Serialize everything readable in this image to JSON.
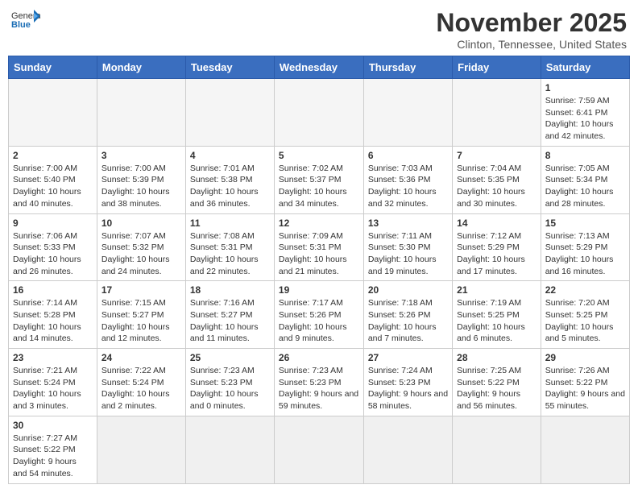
{
  "header": {
    "logo_general": "General",
    "logo_blue": "Blue",
    "month_title": "November 2025",
    "subtitle": "Clinton, Tennessee, United States"
  },
  "days_of_week": [
    "Sunday",
    "Monday",
    "Tuesday",
    "Wednesday",
    "Thursday",
    "Friday",
    "Saturday"
  ],
  "weeks": [
    [
      {
        "day": "",
        "info": ""
      },
      {
        "day": "",
        "info": ""
      },
      {
        "day": "",
        "info": ""
      },
      {
        "day": "",
        "info": ""
      },
      {
        "day": "",
        "info": ""
      },
      {
        "day": "",
        "info": ""
      },
      {
        "day": "1",
        "info": "Sunrise: 7:59 AM\nSunset: 6:41 PM\nDaylight: 10 hours and 42 minutes."
      }
    ],
    [
      {
        "day": "2",
        "info": "Sunrise: 7:00 AM\nSunset: 5:40 PM\nDaylight: 10 hours and 40 minutes."
      },
      {
        "day": "3",
        "info": "Sunrise: 7:00 AM\nSunset: 5:39 PM\nDaylight: 10 hours and 38 minutes."
      },
      {
        "day": "4",
        "info": "Sunrise: 7:01 AM\nSunset: 5:38 PM\nDaylight: 10 hours and 36 minutes."
      },
      {
        "day": "5",
        "info": "Sunrise: 7:02 AM\nSunset: 5:37 PM\nDaylight: 10 hours and 34 minutes."
      },
      {
        "day": "6",
        "info": "Sunrise: 7:03 AM\nSunset: 5:36 PM\nDaylight: 10 hours and 32 minutes."
      },
      {
        "day": "7",
        "info": "Sunrise: 7:04 AM\nSunset: 5:35 PM\nDaylight: 10 hours and 30 minutes."
      },
      {
        "day": "8",
        "info": "Sunrise: 7:05 AM\nSunset: 5:34 PM\nDaylight: 10 hours and 28 minutes."
      }
    ],
    [
      {
        "day": "9",
        "info": "Sunrise: 7:06 AM\nSunset: 5:33 PM\nDaylight: 10 hours and 26 minutes."
      },
      {
        "day": "10",
        "info": "Sunrise: 7:07 AM\nSunset: 5:32 PM\nDaylight: 10 hours and 24 minutes."
      },
      {
        "day": "11",
        "info": "Sunrise: 7:08 AM\nSunset: 5:31 PM\nDaylight: 10 hours and 22 minutes."
      },
      {
        "day": "12",
        "info": "Sunrise: 7:09 AM\nSunset: 5:31 PM\nDaylight: 10 hours and 21 minutes."
      },
      {
        "day": "13",
        "info": "Sunrise: 7:11 AM\nSunset: 5:30 PM\nDaylight: 10 hours and 19 minutes."
      },
      {
        "day": "14",
        "info": "Sunrise: 7:12 AM\nSunset: 5:29 PM\nDaylight: 10 hours and 17 minutes."
      },
      {
        "day": "15",
        "info": "Sunrise: 7:13 AM\nSunset: 5:29 PM\nDaylight: 10 hours and 16 minutes."
      }
    ],
    [
      {
        "day": "16",
        "info": "Sunrise: 7:14 AM\nSunset: 5:28 PM\nDaylight: 10 hours and 14 minutes."
      },
      {
        "day": "17",
        "info": "Sunrise: 7:15 AM\nSunset: 5:27 PM\nDaylight: 10 hours and 12 minutes."
      },
      {
        "day": "18",
        "info": "Sunrise: 7:16 AM\nSunset: 5:27 PM\nDaylight: 10 hours and 11 minutes."
      },
      {
        "day": "19",
        "info": "Sunrise: 7:17 AM\nSunset: 5:26 PM\nDaylight: 10 hours and 9 minutes."
      },
      {
        "day": "20",
        "info": "Sunrise: 7:18 AM\nSunset: 5:26 PM\nDaylight: 10 hours and 7 minutes."
      },
      {
        "day": "21",
        "info": "Sunrise: 7:19 AM\nSunset: 5:25 PM\nDaylight: 10 hours and 6 minutes."
      },
      {
        "day": "22",
        "info": "Sunrise: 7:20 AM\nSunset: 5:25 PM\nDaylight: 10 hours and 5 minutes."
      }
    ],
    [
      {
        "day": "23",
        "info": "Sunrise: 7:21 AM\nSunset: 5:24 PM\nDaylight: 10 hours and 3 minutes."
      },
      {
        "day": "24",
        "info": "Sunrise: 7:22 AM\nSunset: 5:24 PM\nDaylight: 10 hours and 2 minutes."
      },
      {
        "day": "25",
        "info": "Sunrise: 7:23 AM\nSunset: 5:23 PM\nDaylight: 10 hours and 0 minutes."
      },
      {
        "day": "26",
        "info": "Sunrise: 7:23 AM\nSunset: 5:23 PM\nDaylight: 9 hours and 59 minutes."
      },
      {
        "day": "27",
        "info": "Sunrise: 7:24 AM\nSunset: 5:23 PM\nDaylight: 9 hours and 58 minutes."
      },
      {
        "day": "28",
        "info": "Sunrise: 7:25 AM\nSunset: 5:22 PM\nDaylight: 9 hours and 56 minutes."
      },
      {
        "day": "29",
        "info": "Sunrise: 7:26 AM\nSunset: 5:22 PM\nDaylight: 9 hours and 55 minutes."
      }
    ],
    [
      {
        "day": "30",
        "info": "Sunrise: 7:27 AM\nSunset: 5:22 PM\nDaylight: 9 hours and 54 minutes."
      },
      {
        "day": "",
        "info": ""
      },
      {
        "day": "",
        "info": ""
      },
      {
        "day": "",
        "info": ""
      },
      {
        "day": "",
        "info": ""
      },
      {
        "day": "",
        "info": ""
      },
      {
        "day": "",
        "info": ""
      }
    ]
  ]
}
